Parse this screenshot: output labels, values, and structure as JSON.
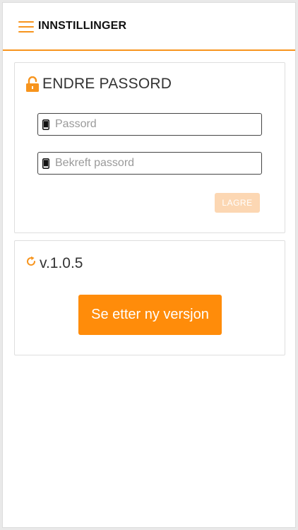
{
  "header": {
    "title": "INNSTILLINGER",
    "menu_icon": "hamburger-menu-icon"
  },
  "password_card": {
    "title": "ENDRE PASSORD",
    "title_icon": "unlocked-padlock-icon",
    "password_field": {
      "placeholder": "Passord",
      "value": "",
      "icon": "mobile-phone-icon"
    },
    "confirm_field": {
      "placeholder": "Bekreft passord",
      "value": "",
      "icon": "mobile-phone-icon"
    },
    "save_label": "LAGRE"
  },
  "version_card": {
    "version": "v.1.0.5",
    "version_icon": "refresh-icon",
    "check_label": "Se etter ny versjon"
  },
  "colors": {
    "accent": "#f7941d",
    "button": "#ff8c0a",
    "button_disabled": "#fcd7b3"
  }
}
